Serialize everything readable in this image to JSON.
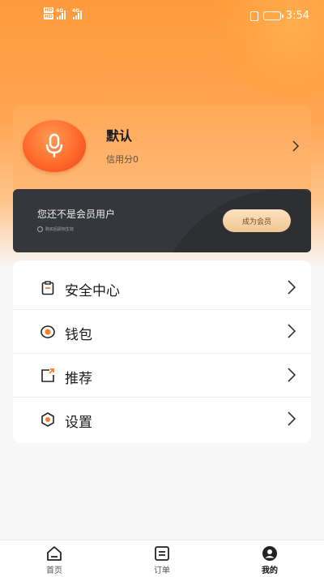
{
  "status_bar": {
    "time": "3:54",
    "network_label_1": "4G",
    "network_label_2": "4G",
    "hd_label_1": "HD",
    "hd_label_2": "HD"
  },
  "profile": {
    "name": "默认",
    "credit": "信用分0",
    "avatar_icon": "microphone-icon"
  },
  "membership": {
    "title": "您还不是会员用户",
    "subtitle": "购买后即刻生效",
    "button_label": "成为会员"
  },
  "menu": {
    "items": [
      {
        "label": "安全中心",
        "icon": "clipboard-icon"
      },
      {
        "label": "钱包",
        "icon": "wallet-icon"
      },
      {
        "label": "推荐",
        "icon": "share-icon"
      },
      {
        "label": "设置",
        "icon": "settings-hexagon-icon"
      }
    ]
  },
  "tabbar": {
    "items": [
      {
        "label": "首页",
        "icon": "home-icon"
      },
      {
        "label": "订单",
        "icon": "order-list-icon"
      },
      {
        "label": "我的",
        "icon": "profile-icon",
        "active": true
      }
    ]
  },
  "colors": {
    "accent": "#ff9a3c",
    "member_card": "#35373c",
    "member_button": "#f0c690"
  }
}
